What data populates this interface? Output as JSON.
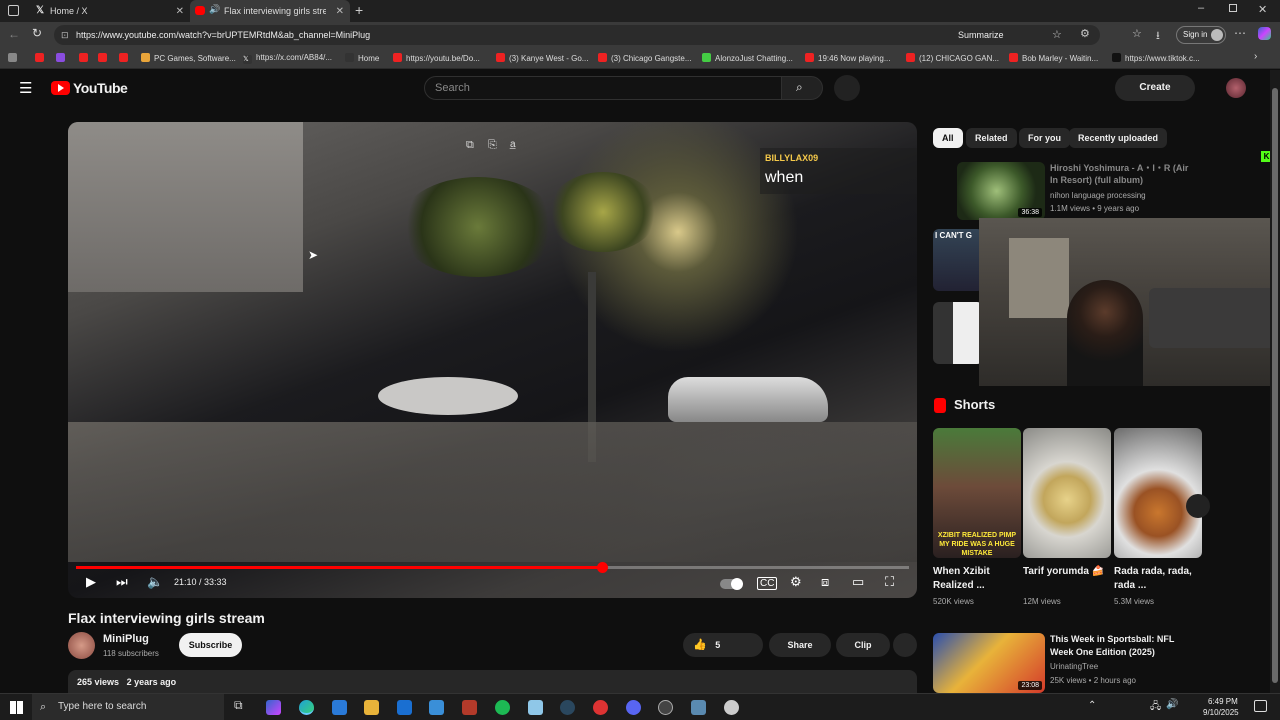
{
  "browser": {
    "tabs": [
      {
        "title": "Home / X"
      },
      {
        "title": "Flax interviewing girls stream"
      }
    ],
    "url": "https://www.youtube.com/watch?v=brUPTEMRtdM&ab_channel=MiniPlug",
    "summarize_label": "Summarize",
    "sign_in_label": "Sign in",
    "bookmarks": [
      {
        "label": "PC Games, Software..."
      },
      {
        "label": "https://x.com/AB84/..."
      },
      {
        "label": "Home"
      },
      {
        "label": "https://youtu.be/Do..."
      },
      {
        "label": "(3) Kanye West - Go..."
      },
      {
        "label": "(3) Chicago Gangste..."
      },
      {
        "label": "AlonzoJust Chatting..."
      },
      {
        "label": "19:46 Now playing..."
      },
      {
        "label": "(12) CHICAGO GAN..."
      },
      {
        "label": "Bob Marley - Waitin..."
      },
      {
        "label": "https://www.tiktok.c..."
      }
    ]
  },
  "youtube": {
    "logo_text": "YouTube",
    "search_placeholder": "Search",
    "create_label": "Create",
    "player": {
      "time": "21:10 / 33:33",
      "progress": 0.631
    },
    "overlay": {
      "chat_user": "BILLYLAX09",
      "chat_message": "when"
    },
    "video_title": "Flax interviewing girls stream",
    "channel": {
      "name": "MiniPlug",
      "subscribers": "118 subscribers",
      "subscribe_label": "Subscribe"
    },
    "actions": {
      "likes": "5",
      "share": "Share",
      "clip": "Clip"
    },
    "description": {
      "views": "265 views",
      "age": "2 years ago"
    },
    "filter_chips": [
      "All",
      "Related",
      "For you",
      "Recently uploaded"
    ],
    "recommended": [
      {
        "title": "Hiroshi Yoshimura - A・I・R (Air In Resort) (full album)",
        "channel": "nihon language processing",
        "meta": "1.1M views • 9 years ago",
        "duration": "36:38"
      },
      {
        "title": "This Week in Sportsball: NFL Week One Edition (2025)",
        "channel": "UrinatingTree",
        "meta": "25K views • 2 hours ago",
        "duration": "23:08"
      }
    ],
    "shorts_heading": "Shorts",
    "shorts": [
      {
        "title": "When Xzibit Realized ...",
        "views": "520K views",
        "caption": "XZIBIT REALIZED PIMP MY RIDE WAS A HUGE MISTAKE"
      },
      {
        "title": "Tarif yorumda 🍰",
        "views": "12M views"
      },
      {
        "title": "Rada rada, rada, rada ...",
        "views": "5.3M views"
      }
    ],
    "second_thumb_label": "I CAN'T G"
  },
  "taskbar": {
    "search_placeholder": "Type here to search",
    "time": "6:49 PM",
    "date": "9/10/2025"
  },
  "colors": {
    "accent": "#ff0000",
    "bg": "#0f0f0f",
    "chat_user": "#f5c94a"
  }
}
